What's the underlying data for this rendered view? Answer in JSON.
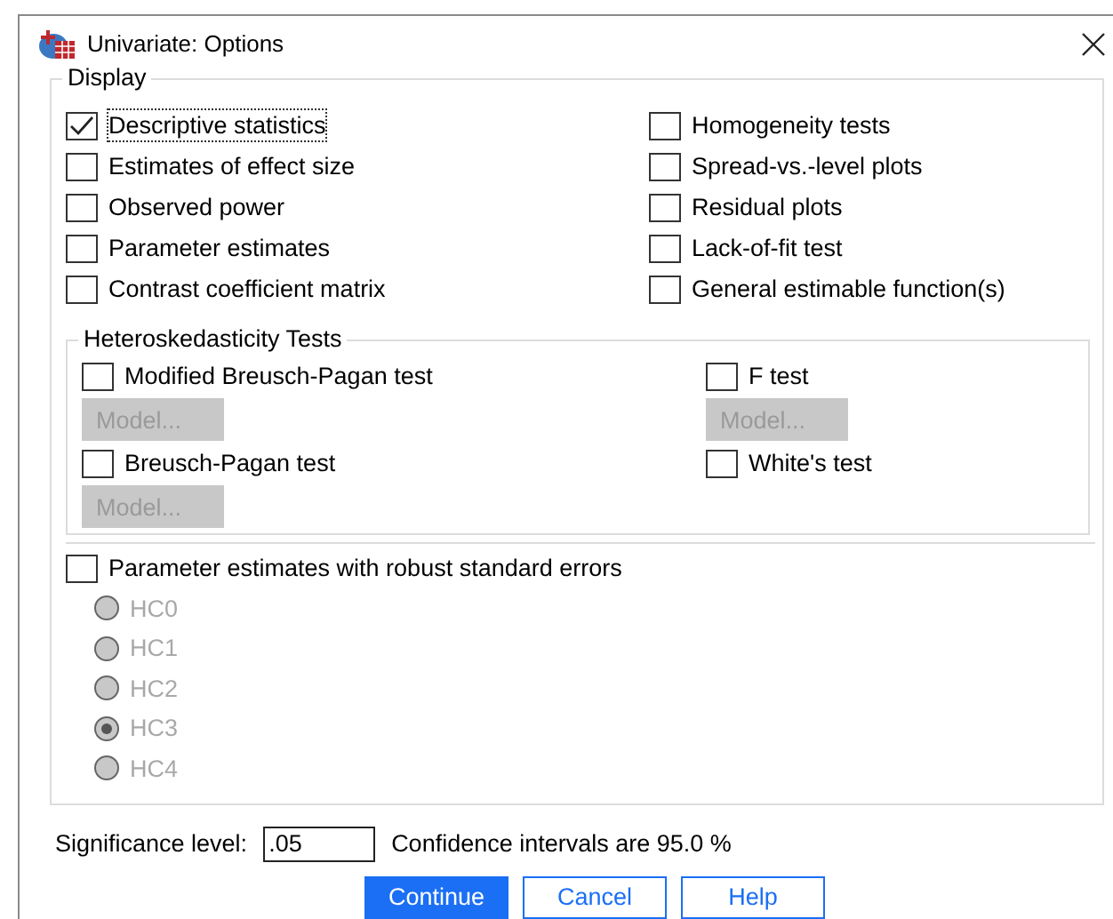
{
  "window": {
    "title": "Univariate: Options"
  },
  "display": {
    "label": "Display",
    "left_options": [
      {
        "label": "Descriptive statistics",
        "checked": true,
        "focused": true
      },
      {
        "label": "Estimates of effect size",
        "checked": false,
        "focused": false
      },
      {
        "label": "Observed power",
        "checked": false,
        "focused": false
      },
      {
        "label": "Parameter estimates",
        "checked": false,
        "focused": false
      },
      {
        "label": "Contrast coefficient matrix",
        "checked": false,
        "focused": false
      }
    ],
    "right_options": [
      {
        "label": "Homogeneity tests",
        "checked": false,
        "focused": false
      },
      {
        "label": "Spread-vs.-level plots",
        "checked": false,
        "focused": false
      },
      {
        "label": "Residual plots",
        "checked": false,
        "focused": false
      },
      {
        "label": "Lack-of-fit test",
        "checked": false,
        "focused": false
      },
      {
        "label": "General estimable function(s)",
        "checked": false,
        "focused": false
      }
    ],
    "heteroskedasticity": {
      "label": "Heteroskedasticity Tests",
      "tests": [
        {
          "label": "Modified Breusch-Pagan test",
          "checked": false,
          "model_button": {
            "label": "Model...",
            "disabled": true
          }
        },
        {
          "label": "F test",
          "checked": false,
          "model_button": {
            "label": "Model...",
            "disabled": true
          }
        },
        {
          "label": "Breusch-Pagan test",
          "checked": false,
          "model_button": {
            "label": "Model...",
            "disabled": true
          }
        },
        {
          "label": "White's test",
          "checked": false
        }
      ]
    },
    "robust": {
      "label": "Parameter estimates with robust standard errors",
      "checked": false,
      "options": [
        {
          "label": "HC0",
          "selected": false,
          "disabled": true
        },
        {
          "label": "HC1",
          "selected": false,
          "disabled": true
        },
        {
          "label": "HC2",
          "selected": false,
          "disabled": true
        },
        {
          "label": "HC3",
          "selected": true,
          "disabled": true
        },
        {
          "label": "HC4",
          "selected": false,
          "disabled": true
        }
      ]
    }
  },
  "significance": {
    "label": "Significance level:",
    "value": ".05"
  },
  "confidence": "Confidence intervals are 95.0 %",
  "buttons": [
    {
      "label": "Continue",
      "default": true
    },
    {
      "label": "Cancel",
      "default": false
    },
    {
      "label": "Help",
      "default": false
    }
  ]
}
